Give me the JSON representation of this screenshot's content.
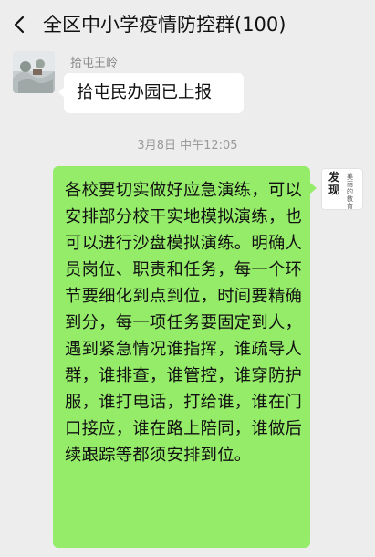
{
  "header": {
    "title": "全区中小学疫情防控群(100)"
  },
  "messages": [
    {
      "sender": "拾屯王岭",
      "text": "拾屯民办园已上报"
    },
    {
      "timestamp": "3月8日 中午12:05"
    },
    {
      "text": "各校要切实做好应急演练，可以安排部分校干实地模拟演练，也可以进行沙盘模拟演练。明确人员岗位、职责和任务，每一个环节要细化到点到位，时间要精确到分，每一项任务要固定到人，遇到紧急情况谁指挥，谁疏导人群，谁排查，谁管控，谁穿防护服，谁打电话，打给谁，谁在门口接应，谁在路上陪同，谁做后续跟踪等都须安排到位。"
    }
  ],
  "self_avatar": {
    "big_text": "发现",
    "small_text": "美丽的教育"
  }
}
